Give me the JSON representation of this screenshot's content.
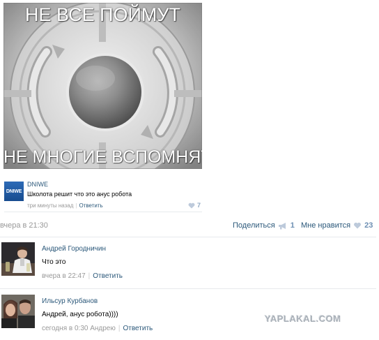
{
  "meme": {
    "top_caption": "НЕ ВСЕ ПОЙМУТ",
    "bottom_caption": "НЕ МНОГИЕ ВСПОМНЯТ"
  },
  "post_comment": {
    "avatar_text": "DNIWE",
    "author": "DNIWE",
    "text": "Школота решит что это анус робота",
    "time": "три минуты назад",
    "reply": "Ответить",
    "likes": "7"
  },
  "post_footer": {
    "date": "вчера в 21:30",
    "share_label": "Поделиться",
    "share_count": "1",
    "like_label": "Мне нравится",
    "like_count": "23"
  },
  "comments": [
    {
      "author": "Андрей Городничин",
      "text": "Что это",
      "time": "вчера в 22:47",
      "reply": "Ответить"
    },
    {
      "author": "Ильсур Курбанов",
      "text": "Андрей, анус робота))))",
      "time": "сегодня в 0:30 Андрею",
      "reply": "Ответить"
    }
  ],
  "watermark": "YAPLAKAL.COM",
  "colors": {
    "link": "#2b587a",
    "muted": "#999999",
    "count": "#6d8fb3",
    "divider": "#e7eaed"
  }
}
